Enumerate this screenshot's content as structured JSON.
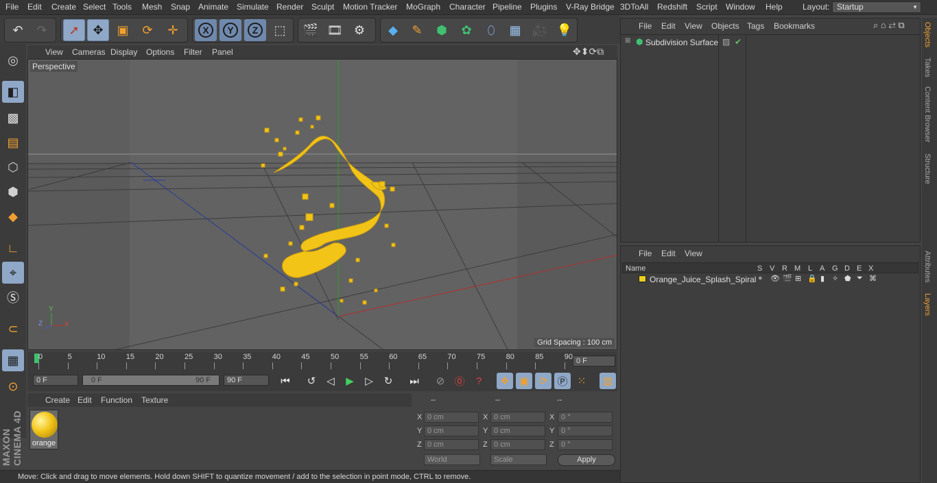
{
  "menubar": {
    "items": [
      "File",
      "Edit",
      "Create",
      "Select",
      "Tools",
      "Mesh",
      "Snap",
      "Animate",
      "Simulate",
      "Render",
      "Sculpt",
      "Motion Tracker",
      "MoGraph",
      "Character",
      "Pipeline",
      "Plugins",
      "V-Ray Bridge",
      "3DToAll",
      "Redshift",
      "Script",
      "Window",
      "Help"
    ],
    "layout_label": "Layout:",
    "layout_value": "Startup"
  },
  "toolbar": {
    "axis_x": "X",
    "axis_y": "Y",
    "axis_z": "Z"
  },
  "viewport": {
    "menu": [
      "View",
      "Cameras",
      "Display",
      "Options",
      "Filter",
      "Panel"
    ],
    "label": "Perspective",
    "grid_spacing": "Grid Spacing : 100 cm",
    "axis_y": "Y",
    "axis_z": "Z",
    "axis_x": "X"
  },
  "timeline": {
    "ticks": [
      "0",
      "5",
      "10",
      "15",
      "20",
      "25",
      "30",
      "35",
      "40",
      "45",
      "50",
      "55",
      "60",
      "65",
      "70",
      "75",
      "80",
      "85",
      "90"
    ],
    "current_frame": "0 F",
    "start_field": "0 F",
    "range_start": "0 F",
    "range_end": "90 F",
    "end_field": "90 F"
  },
  "material_manager": {
    "menu": [
      "Create",
      "Edit",
      "Function",
      "Texture"
    ],
    "material_name": "orange"
  },
  "coordinates": {
    "headers": [
      "--",
      "--",
      "--"
    ],
    "rows": [
      {
        "axis": "X",
        "pos": "0 cm",
        "size_axis": "X",
        "size": "0 cm",
        "rot_axis": "X",
        "rot": "0 °"
      },
      {
        "axis": "Y",
        "pos": "0 cm",
        "size_axis": "Y",
        "size": "0 cm",
        "rot_axis": "Y",
        "rot": "0 °"
      },
      {
        "axis": "Z",
        "pos": "0 cm",
        "size_axis": "Z",
        "size": "0 cm",
        "rot_axis": "Z",
        "rot": "0 °"
      }
    ],
    "mode_select": "World",
    "scale_select": "Scale",
    "apply_label": "Apply"
  },
  "status": {
    "text": "Move: Click and drag to move elements. Hold down SHIFT to quantize movement / add to the selection in point mode, CTRL to remove."
  },
  "object_manager": {
    "menu": [
      "File",
      "Edit",
      "View",
      "Objects",
      "Tags",
      "Bookmarks"
    ],
    "objects": [
      "Subdivision Surface"
    ]
  },
  "layer_manager": {
    "menu": [
      "File",
      "Edit",
      "View"
    ],
    "columns": [
      "Name",
      "S",
      "V",
      "R",
      "M",
      "L",
      "A",
      "G",
      "D",
      "E",
      "X"
    ],
    "layers": [
      "Orange_Juice_Splash_Spiral"
    ],
    "layer_color": "#e8d020"
  },
  "side_tabs": [
    "Objects",
    "Takes",
    "Content Browser",
    "Structure",
    "Attributes",
    "Layers"
  ],
  "maxon_logo": "MAXON CINEMA 4D",
  "colors": {
    "accent": "#f0a030",
    "selection": "#8fa8c8",
    "splash": "#f2c418"
  }
}
